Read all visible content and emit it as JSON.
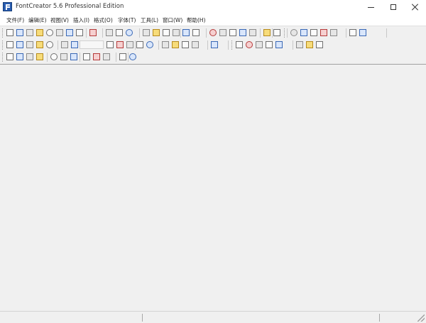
{
  "window": {
    "title": "FontCreator 5.6 Professional Edition",
    "controls": [
      "minimize",
      "maximize",
      "close"
    ]
  },
  "menu": [
    {
      "label": "文件(F)"
    },
    {
      "label": "编辑(E)"
    },
    {
      "label": "视图(V)"
    },
    {
      "label": "插入(I)"
    },
    {
      "label": "格式(O)"
    },
    {
      "label": "字体(T)"
    },
    {
      "label": "工具(L)"
    },
    {
      "label": "窗口(W)"
    },
    {
      "label": "帮助(H)"
    }
  ],
  "toolbar_icons": {
    "row1": [
      "new-icon",
      "open-icon",
      "folder-open-icon",
      "save-icon",
      "save-all-icon",
      "print-icon",
      "export-icon",
      "font-properties-icon",
      "find-icon",
      "cut-icon",
      "copy-icon",
      "paste-icon",
      "undo-icon",
      "redo-icon",
      "refresh-icon",
      "import-icon",
      "glyph-properties-icon",
      "metrics-icon",
      "kerning-icon",
      "validate-icon",
      "test-icon",
      "preview-icon",
      "character-map-icon",
      "outline-icon",
      "transform-icon",
      "rotate-icon",
      "flip-icon",
      "skew-icon",
      "contour-icon",
      "union-icon",
      "intersect-icon",
      "subtract-icon"
    ],
    "row2": [
      "select-icon",
      "lasso-icon",
      "hand-icon",
      "knife-icon",
      "pen-icon",
      "zoom-in-icon",
      "zoom-out-icon",
      "grid-icon",
      "guides-icon",
      "point-icon",
      "curve-icon",
      "shape-icon",
      "line-icon",
      "rectangle-icon",
      "ellipse-icon",
      "fill-icon",
      "stroke-icon",
      "align-icon",
      "distribute-icon",
      "node-icon",
      "break-icon",
      "join-icon",
      "snap-icon",
      "measure-icon",
      "mirror-icon"
    ],
    "row3": [
      "components-icon",
      "add-component-icon",
      "remove-component-icon",
      "link-icon",
      "decompose-icon",
      "anchor-icon",
      "hint-icon",
      "auto-hint-icon",
      "optimize-icon",
      "width-icon",
      "spacing-icon",
      "baseline-icon"
    ]
  },
  "status": {
    "panels": [
      "",
      "",
      ""
    ]
  }
}
